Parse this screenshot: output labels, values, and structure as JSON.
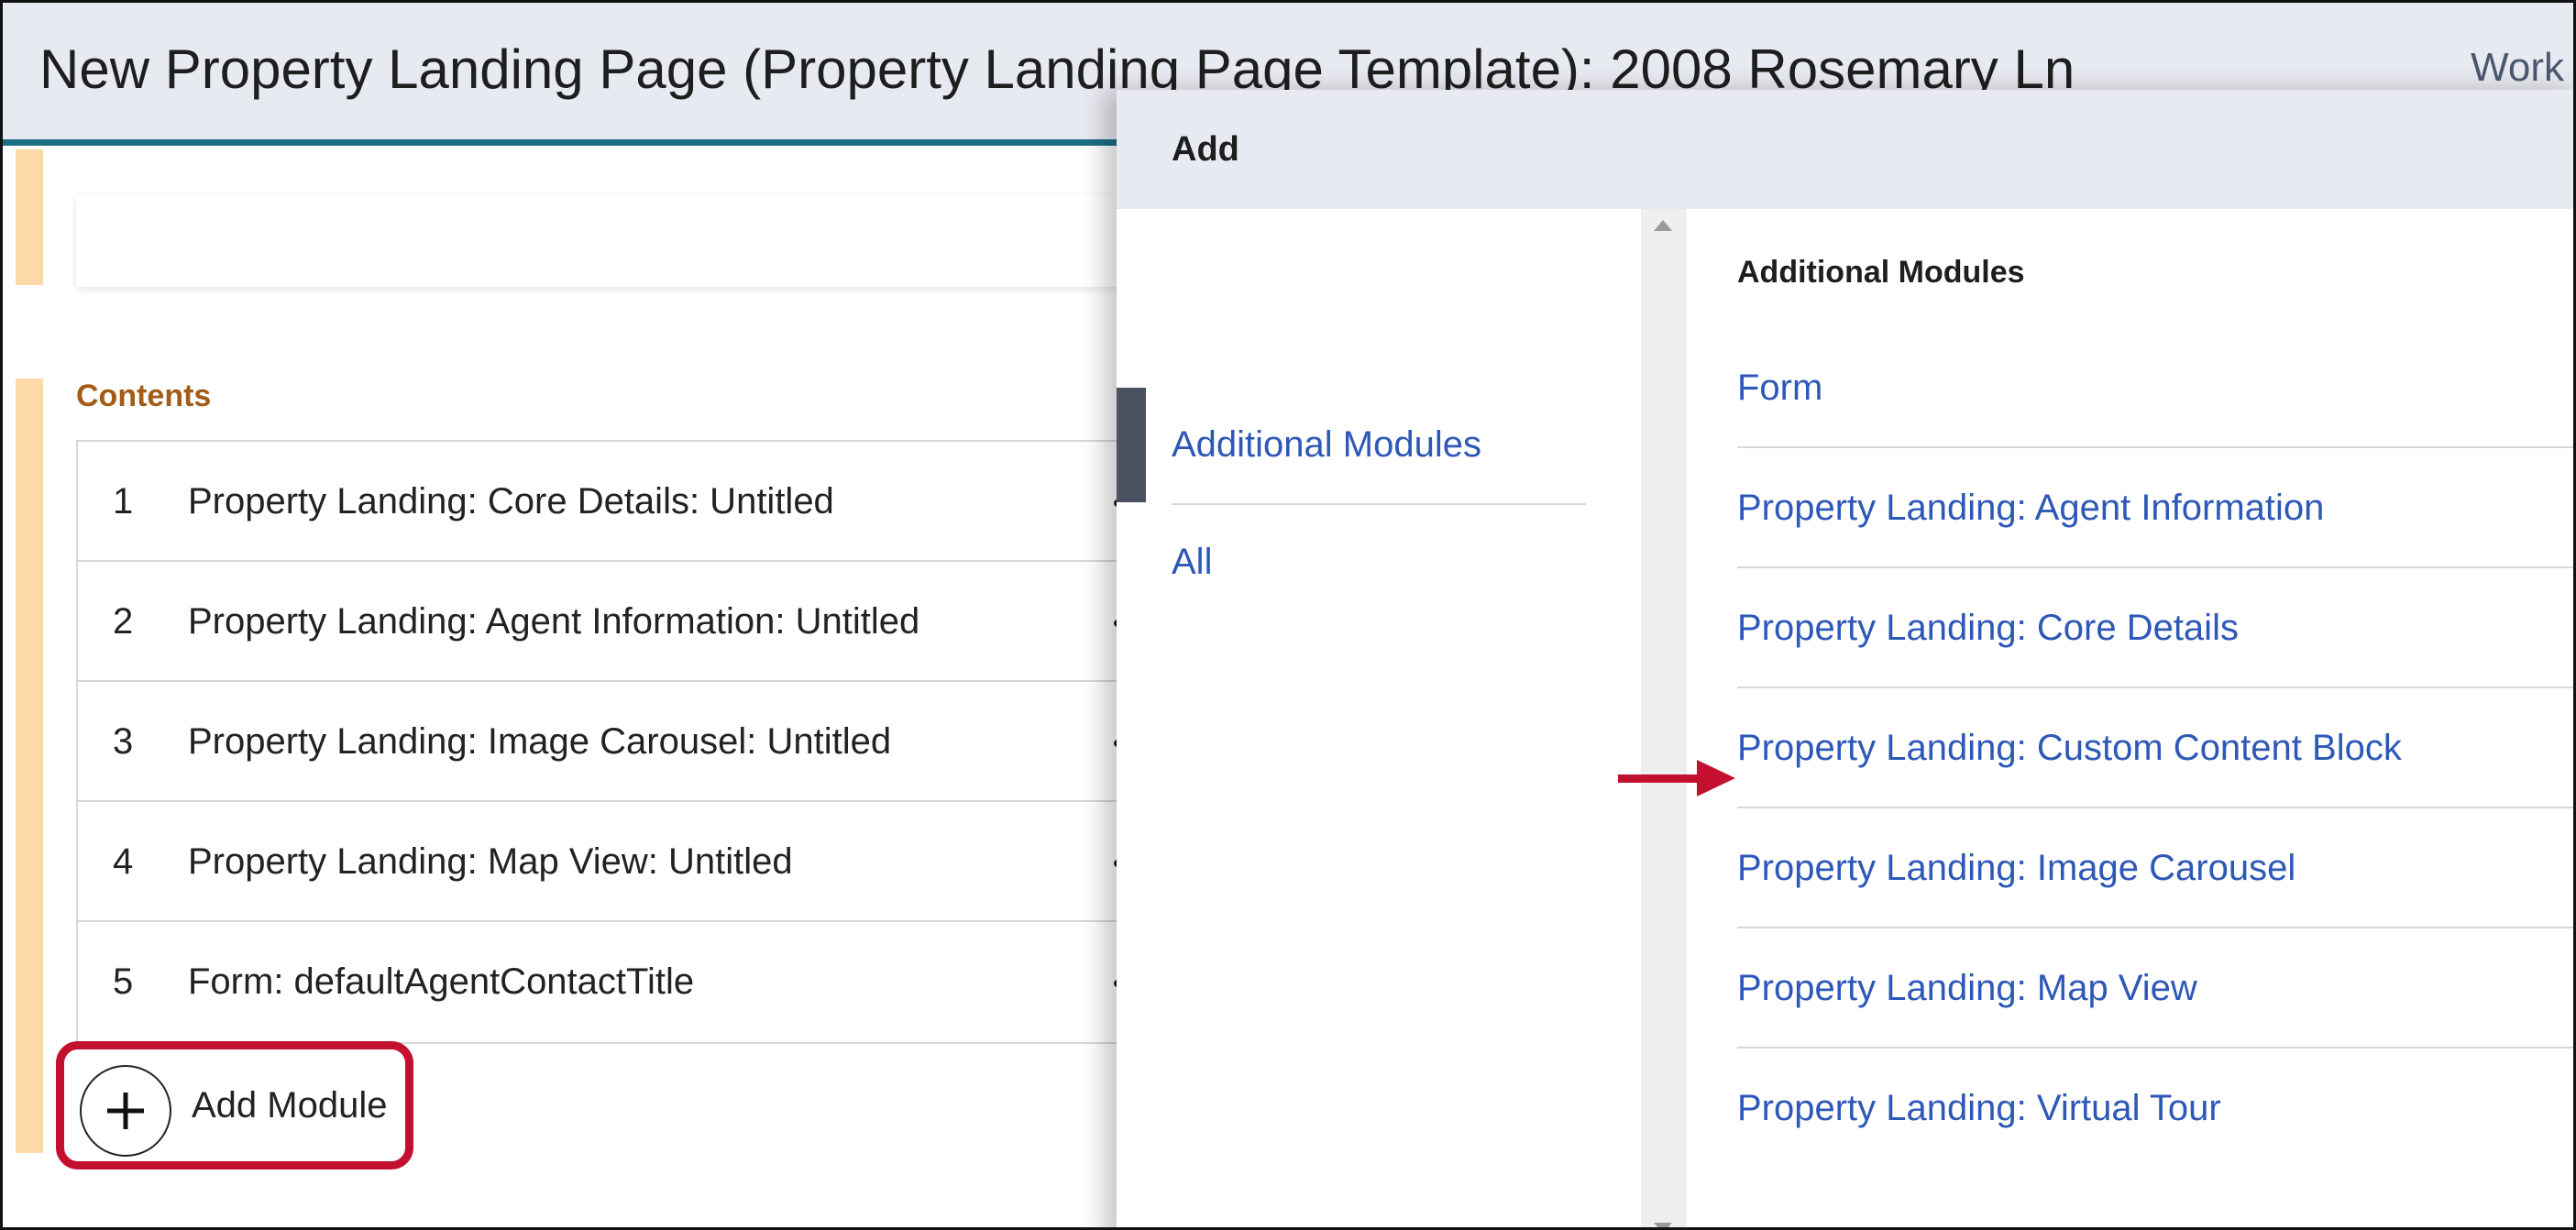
{
  "header": {
    "title": "New Property Landing Page (Property Landing Page Template): 2008 Rosemary Ln",
    "right_link": "Work"
  },
  "contents": {
    "label": "Contents",
    "modules": [
      {
        "num": "1",
        "label": "Property Landing: Core Details: Untitled"
      },
      {
        "num": "2",
        "label": "Property Landing: Agent Information: Untitled"
      },
      {
        "num": "3",
        "label": "Property Landing: Image Carousel: Untitled"
      },
      {
        "num": "4",
        "label": "Property Landing: Map View: Untitled"
      },
      {
        "num": "5",
        "label": "Form: defaultAgentContactTitle"
      }
    ],
    "add_module_label": "Add Module"
  },
  "dialog": {
    "title": "Add",
    "nav": {
      "selected": "Additional Modules",
      "items": [
        "Additional Modules",
        "All"
      ]
    },
    "pane_heading": "Additional Modules",
    "options": [
      "Form",
      "Property Landing: Agent Information",
      "Property Landing: Core Details",
      "Property Landing: Custom Content Block",
      "Property Landing: Image Carousel",
      "Property Landing: Map View",
      "Property Landing: Virtual Tour"
    ],
    "highlighted_option": "Property Landing: Custom Content Block"
  },
  "colors": {
    "link_blue": "#2d58b8",
    "annotation_red": "#c4102f",
    "accent_orange": "#fcd9a6",
    "header_bg": "#e8eaf1",
    "header_rule": "#1d6f86"
  }
}
